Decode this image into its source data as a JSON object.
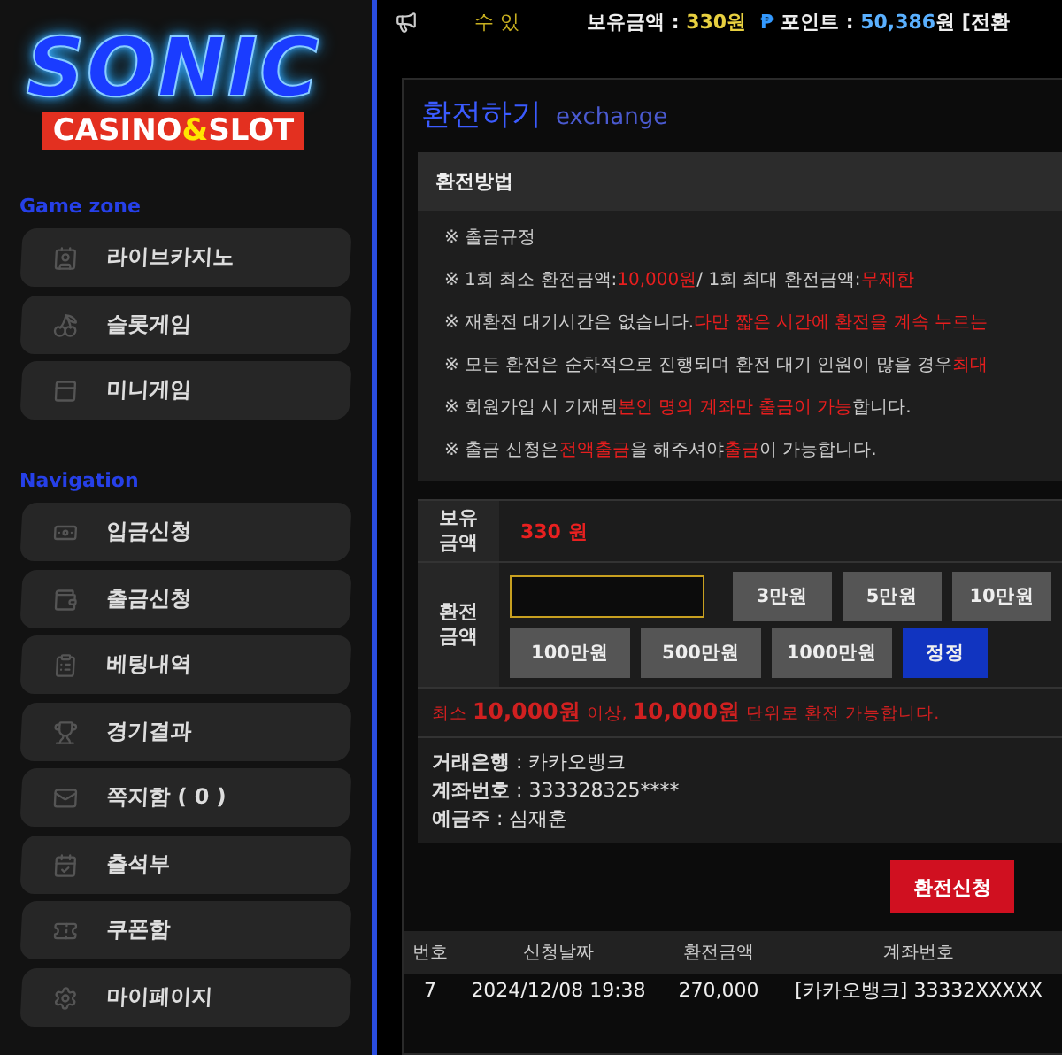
{
  "logo": {
    "title": "SONIC",
    "subtitle": [
      {
        "text": "CASINO",
        "accent": false
      },
      {
        "text": "&",
        "accent": true
      },
      {
        "text": "SLOT",
        "accent": false
      }
    ]
  },
  "sidebar": [
    {
      "heading": "Game zone",
      "items": [
        {
          "label": "라이브카지노"
        },
        {
          "label": "슬롯게임"
        },
        {
          "label": "미니게임"
        }
      ]
    },
    {
      "heading": "Navigation",
      "items": [
        {
          "label": "입금신청"
        },
        {
          "label": "출금신청"
        },
        {
          "label": "베팅내역"
        },
        {
          "label": "경기결과"
        },
        {
          "label": "쪽지함 ( 0 )"
        },
        {
          "label": "출석부"
        },
        {
          "label": "쿠폰함"
        },
        {
          "label": "마이페이지"
        }
      ]
    }
  ],
  "top_bar": {
    "marquee": "수 있",
    "balance_label": "보유금액 :",
    "balance": "330원",
    "point_symbol": "₱",
    "point_label": "포인트 :",
    "point": "50,386",
    "point_unit": "원 [전환"
  },
  "page_title": "환전하기",
  "page_subtitle": "exchange",
  "rules": {
    "heading": "환전방법",
    "lines": [
      [
        {
          "text": "※ 출금규정",
          "red": false
        }
      ],
      [
        {
          "text": "※ 1회 최소 환전금액: ",
          "red": false
        },
        {
          "text": "10,000원",
          "red": true
        },
        {
          "text": " / 1회 최대 환전금액: ",
          "red": false
        },
        {
          "text": "무제한",
          "red": true
        }
      ],
      [
        {
          "text": "※ 재환전 대기시간은 없습니다. ",
          "red": false
        },
        {
          "text": "다만 짧은 시간에 환전을 계속 누르는",
          "red": true
        }
      ],
      [
        {
          "text": "※ 모든 환전은 순차적으로 진행되며 환전 대기 인원이 많을 경우 ",
          "red": false
        },
        {
          "text": "최대",
          "red": true
        }
      ],
      [
        {
          "text": "※ 회원가입 시 기재된 ",
          "red": false
        },
        {
          "text": "본인 명의 계좌만 출금이 가능",
          "red": true
        },
        {
          "text": " 합니다.",
          "red": false
        }
      ],
      [
        {
          "text": "※ 출금 신청은 ",
          "red": false
        },
        {
          "text": "전액출금",
          "red": true
        },
        {
          "text": " 을 해주셔야 ",
          "red": false
        },
        {
          "text": "출금",
          "red": true
        },
        {
          "text": "이 가능합니다.",
          "red": false
        }
      ]
    ]
  },
  "form": {
    "balance_label": "보유\n금액",
    "balance": "330 원",
    "amount_label": "환전\n금액",
    "buttons": [
      {
        "label": "3만원",
        "kind": "amount"
      },
      {
        "label": "5만원",
        "kind": "amount"
      },
      {
        "label": "10만원",
        "kind": "amount"
      },
      {
        "label": "100만원",
        "kind": "amount"
      },
      {
        "label": "500만원",
        "kind": "amount"
      },
      {
        "label": "1000만원",
        "kind": "amount"
      },
      {
        "label": "정정",
        "kind": "reset"
      }
    ],
    "notice": [
      {
        "text": "최소 ",
        "big": false
      },
      {
        "text": "10,000원",
        "big": true
      },
      {
        "text": " 이상, ",
        "big": false
      },
      {
        "text": "10,000원",
        "big": true
      },
      {
        "text": "  단위로 환전 가능합니다.",
        "big": false
      }
    ],
    "bank": [
      {
        "label": "거래은행",
        "value": ": 카카오뱅크"
      },
      {
        "label": "계좌번호",
        "value": ": 333328325****"
      },
      {
        "label": "예금주",
        "value": ": 심재훈"
      }
    ]
  },
  "submit": "환전신청",
  "table": {
    "columns": [
      "번호",
      "신청날짜",
      "환전금액",
      "계좌번호"
    ],
    "rows": [
      [
        "7",
        "2024/12/08 19:38",
        "270,000",
        "[카카오뱅크] 33332XXXXX"
      ]
    ]
  }
}
